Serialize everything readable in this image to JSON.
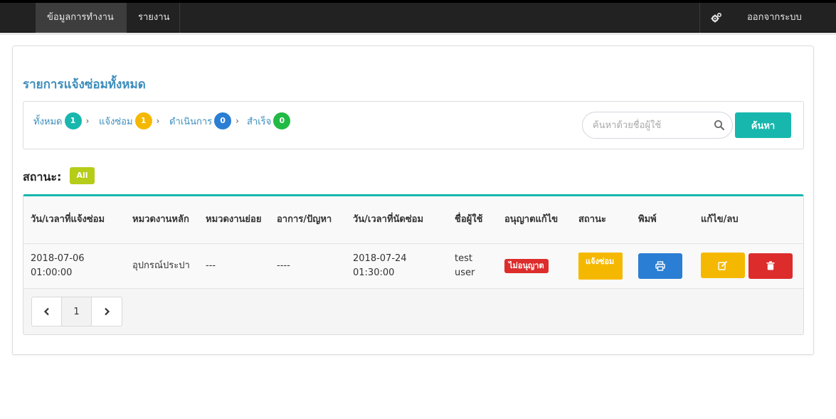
{
  "nav": {
    "items": [
      "ข้อมูลการทำงาน",
      "รายงาน"
    ],
    "logout": "ออกจากระบบ"
  },
  "page": {
    "title": "รายการแจ้งซ่อมทั้งหมด"
  },
  "filters": [
    {
      "label": "ทั้งหมด",
      "count": "1",
      "color": "#17b7ad"
    },
    {
      "label": "แจ้งซ่อม",
      "count": "1",
      "color": "#f5b800"
    },
    {
      "label": "ดำเนินการ",
      "count": "0",
      "color": "#2a7ed3"
    },
    {
      "label": "สำเร็จ",
      "count": "0",
      "color": "#21ba45"
    }
  ],
  "search": {
    "placeholder": "ค้นหาด้วยชื่อผู้ใช้",
    "button": "ค้นหา"
  },
  "status": {
    "label": "สถานะ:",
    "all": "All"
  },
  "table": {
    "headers": [
      "วัน/เวลาที่แจ้งซ่อม",
      "หมวดงานหลัก",
      "หมวดงานย่อย",
      "อาการ/ปัญหา",
      "วัน/เวลาที่นัดซ่อม",
      "ชื่อผู้ใช้",
      "อนุญาตแก้ไข",
      "สถานะ",
      "พิมพ์",
      "แก้ไข/ลบ"
    ],
    "rows": [
      {
        "reported": "2018-07-06 01:00:00",
        "main_category": "อุปกรณ์ประปา",
        "sub_category": "---",
        "problem": "----",
        "appointment": "2018-07-24 01:30:00",
        "user": "test user",
        "permission": "ไม่อนุญาต",
        "status": "แจ้งซ่อม"
      }
    ]
  },
  "pagination": {
    "current": "1"
  }
}
